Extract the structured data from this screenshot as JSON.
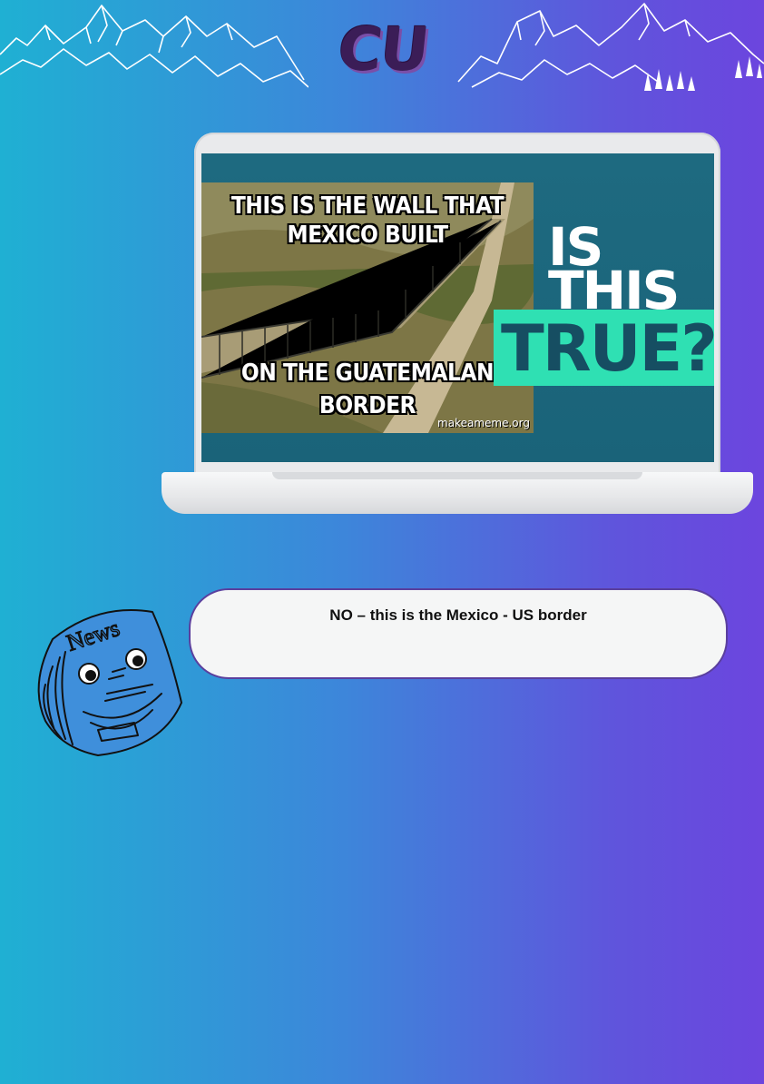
{
  "header": {
    "logo_text": "CU"
  },
  "laptop": {
    "meme": {
      "top_line_1": "THIS IS THE WALL THAT",
      "top_line_2": "MEXICO BUILT",
      "bottom_line_1": "ON THE GUATEMALAN",
      "bottom_line_2": "BORDER",
      "credit": "makeameme.org"
    },
    "question": {
      "line_1": "IS",
      "line_2": "THIS",
      "line_3": "TRUE?"
    }
  },
  "bubble": {
    "text": "NO – this is the Mexico - US border"
  },
  "character": {
    "label": "News"
  }
}
